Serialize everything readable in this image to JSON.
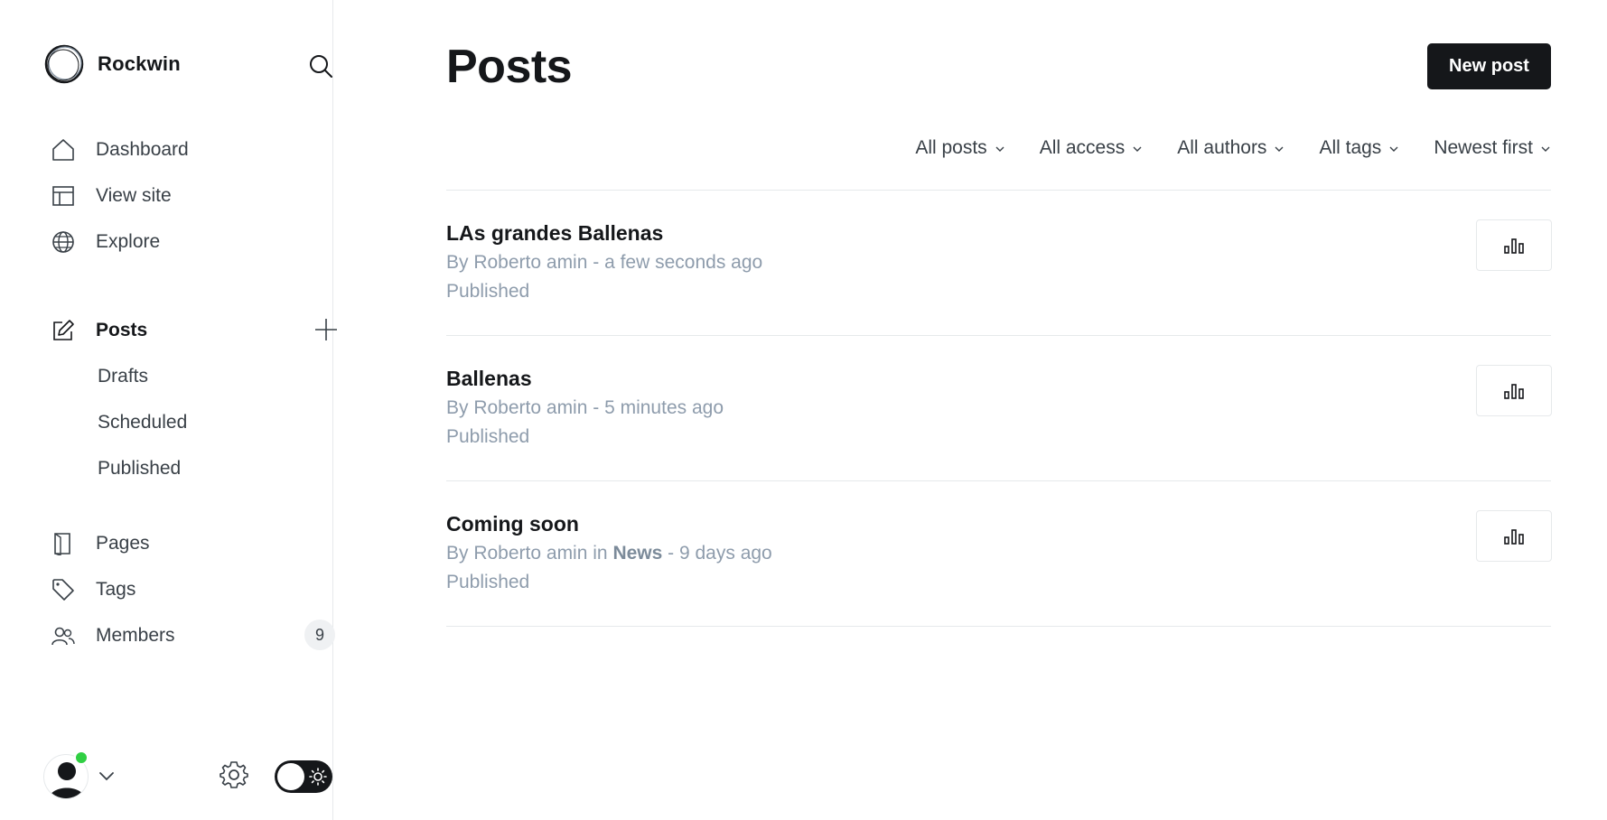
{
  "brand": {
    "name": "Rockwin"
  },
  "nav": {
    "dashboard": "Dashboard",
    "view_site": "View site",
    "explore": "Explore",
    "posts": "Posts",
    "drafts": "Drafts",
    "scheduled": "Scheduled",
    "published": "Published",
    "pages": "Pages",
    "tags": "Tags",
    "members": "Members",
    "members_count": "9"
  },
  "main": {
    "title": "Posts",
    "new_post_label": "New post",
    "filters": [
      "All posts",
      "All access",
      "All authors",
      "All tags",
      "Newest first"
    ]
  },
  "posts": [
    {
      "title": "LAs grandes Ballenas",
      "author": "By Roberto amin",
      "tag": "",
      "time": "a few seconds ago",
      "status": "Published"
    },
    {
      "title": "Ballenas",
      "author": "By Roberto amin",
      "tag": "",
      "time": "5 minutes ago",
      "status": "Published"
    },
    {
      "title": "Coming soon",
      "author": "By Roberto amin",
      "in_label": "in",
      "tag": "News",
      "time": "9 days ago",
      "status": "Published"
    }
  ],
  "colors": {
    "accent": "#15171a",
    "online": "#30cf43",
    "muted_text": "#8e9cac"
  }
}
